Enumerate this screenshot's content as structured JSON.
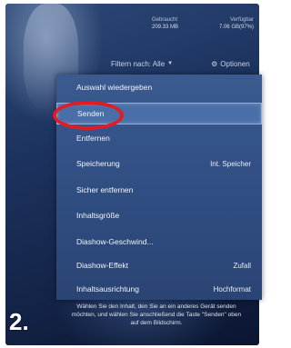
{
  "storage": {
    "used_label": "Gebraucht",
    "used_value": "209.33 MB",
    "free_label": "Verfügbar",
    "free_value": "7.06 GB(97%)"
  },
  "toolbar": {
    "filter_label": "Filtern nach: Alle",
    "options_label": "Optionen"
  },
  "menu": {
    "items": [
      {
        "label": "Auswahl wiedergeben",
        "value": ""
      },
      {
        "label": "Senden",
        "value": ""
      },
      {
        "label": "Entfernen",
        "value": ""
      },
      {
        "label": "Speicherung",
        "value": "Int. Speicher"
      },
      {
        "label": "Sicher entfernen",
        "value": ""
      },
      {
        "label": "Inhaltsgröße",
        "value": ""
      },
      {
        "label": "Diashow-Geschwind...",
        "value": ""
      },
      {
        "label": "Diashow-Effekt",
        "value": "Zufall"
      },
      {
        "label": "Inhaltsausrichtung",
        "value": "Hochformat"
      }
    ],
    "selected_index": 1
  },
  "hint_text": "Wählen Sie den Inhalt, den Sie an ein anderes Gerät senden möchten, und wählen Sie anschließend die Taste \"Senden\" oben auf dem Bildschirm.",
  "step_label": "2.",
  "colors": {
    "highlight_ring": "#e31b23",
    "menu_bg": "#3a5a90",
    "selected_bg": "#4a6fa8"
  }
}
